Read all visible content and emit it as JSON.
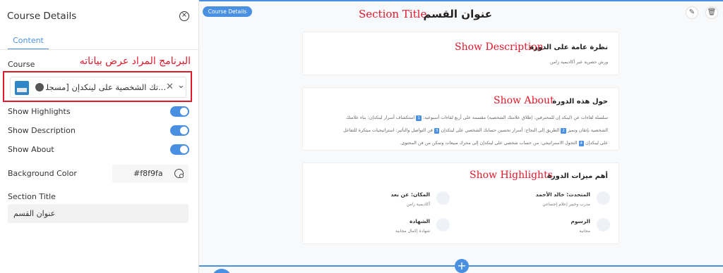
{
  "panel": {
    "title": "Course Details",
    "tab_content": "Content",
    "course_label": "Course",
    "course_annotation": "البرنامج المراد عرض بياناته",
    "course_value": "...تك الشخصية على لينكدإن [مسجلة]",
    "toggles": [
      {
        "label": "Show Highlights",
        "on": true
      },
      {
        "label": "Show Description",
        "on": true
      },
      {
        "label": "Show About",
        "on": true
      }
    ],
    "bg_color_label": "Background Color",
    "bg_color_value": "#f8f9fa",
    "section_title_label": "Section Title",
    "section_title_value": "عنوان القسم"
  },
  "preview": {
    "badge": "Course Details",
    "section_title": "عنوان القسم",
    "annotations": {
      "section_title": "Section Title",
      "description": "Show Description",
      "about": "Show About",
      "highlights": "Show Highlights"
    },
    "description_card": {
      "heading": "نظرة عامة على الدورة",
      "text": "ورش حصرية عبر أكاديمية زامن"
    },
    "about_card": {
      "heading": "حول هذه الدورة",
      "line1_a": "سلسلة لقاءات عن (لينكد إن للمحترفين: إطلاق علامتك الشخصية) مقسمة على أربع لقاءات أسبوعية:",
      "n1": "1",
      "line1_b": "استكشاف أسرار لينكدإن: بناء علامتك",
      "line2_a": "الشخصية بإتقان وتميز",
      "n2": "2",
      "line2_b": "الطريق إلى النجاح: أسرار تحسين حسابك الشخصي على لينكدإن",
      "n3": "3",
      "line2_c": "فن التواصل والتأثير: استراتيجيات مبتكرة للتفاعل",
      "line3_a": "على لينكدإن",
      "n4": "4",
      "line3_b": "التحول الاستراتيجي: من حساب شخصي على لينكدإن إلى محرك مبيعات وتمكن من فن المحتوى."
    },
    "highlights_card": {
      "heading": "أهم ميزات الدورة",
      "items": [
        {
          "title": "المتحدث: خالد الأحمد",
          "sub": "مدرب وخبير إعلام إجتماعي"
        },
        {
          "title": "المكان: عن بعد",
          "sub": "أكاديمية زامن"
        },
        {
          "title": "الرسوم",
          "sub": "مجانية"
        },
        {
          "title": "الشهادة",
          "sub": "شهادة إكمال مجانية"
        }
      ]
    },
    "accent_color": "#4a90e2",
    "canvas_color": "#f8f9fa",
    "annotation_color": "#e0182a"
  }
}
